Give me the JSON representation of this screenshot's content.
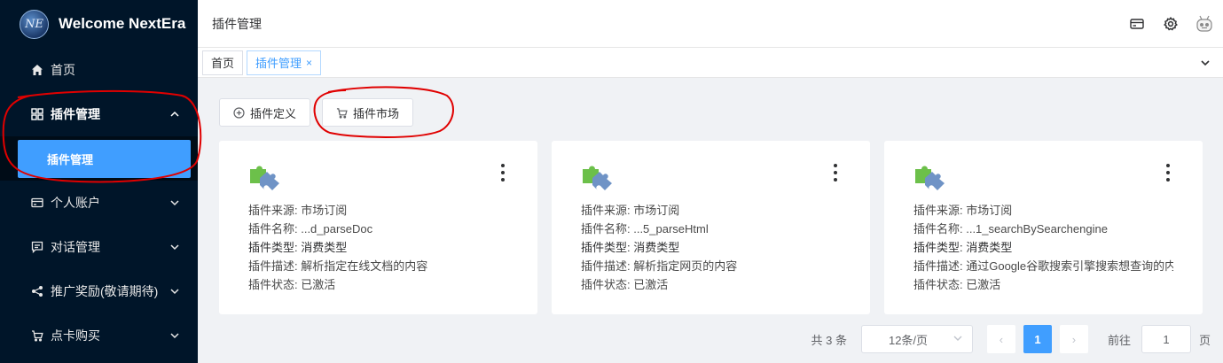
{
  "brand": {
    "title": "Welcome NextEra",
    "logo_text": "NE"
  },
  "sidebar": {
    "items": [
      {
        "label": "首页",
        "icon": "home-icon"
      },
      {
        "label": "插件管理",
        "icon": "grid-icon"
      },
      {
        "label": "个人账户",
        "icon": "card-icon"
      },
      {
        "label": "对话管理",
        "icon": "chat-icon"
      },
      {
        "label": "推广奖励(敬请期待)",
        "icon": "share-icon"
      },
      {
        "label": "点卡购买",
        "icon": "cart-icon"
      }
    ],
    "submenu_active": "插件管理"
  },
  "header": {
    "title": "插件管理",
    "icons": [
      "wallet-icon",
      "settings-icon",
      "robot-avatar-icon"
    ]
  },
  "tabs": [
    {
      "label": "首页",
      "active": false
    },
    {
      "label": "插件管理",
      "active": true,
      "close": "×"
    }
  ],
  "toolbar": {
    "define_label": "插件定义",
    "market_label": "插件市场"
  },
  "cards": [
    {
      "source": "插件来源: 市场订阅",
      "name": "插件名称: ...d_parseDoc",
      "type": "插件类型: 消费类型",
      "desc": "插件描述: 解析指定在线文档的内容",
      "status": "插件状态: 已激活"
    },
    {
      "source": "插件来源: 市场订阅",
      "name": "插件名称: ...5_parseHtml",
      "type": "插件类型: 消费类型",
      "desc": "插件描述: 解析指定网页的内容",
      "status": "插件状态: 已激活"
    },
    {
      "source": "插件来源: 市场订阅",
      "name": "插件名称: ...1_searchBySearchengine",
      "type": "插件类型: 消费类型",
      "desc": "插件描述: 通过Google谷歌搜索引擎搜索想查询的内容",
      "status": "插件状态: 已激活"
    }
  ],
  "pagination": {
    "total": "共 3 条",
    "page_size": "12条/页",
    "current_page": "1",
    "prev": "‹",
    "next": "›",
    "jump_label": "前往",
    "jump_value": "1",
    "jump_suffix": "页"
  },
  "colors": {
    "sidebar_bg": "#001529",
    "accent": "#409eff",
    "annotation": "#e00000"
  }
}
